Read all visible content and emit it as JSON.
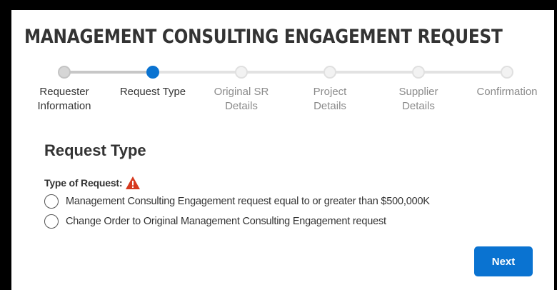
{
  "page": {
    "title": "MANAGEMENT CONSULTING ENGAGEMENT REQUEST"
  },
  "stepper": {
    "current_step": 2,
    "steps": [
      {
        "label": "Requester\nInformation",
        "state": "done"
      },
      {
        "label": "Request Type",
        "state": "active"
      },
      {
        "label": "Original SR\nDetails",
        "state": "pending"
      },
      {
        "label": "Project\nDetails",
        "state": "pending"
      },
      {
        "label": "Supplier\nDetails",
        "state": "pending"
      },
      {
        "label": "Confirmation",
        "state": "pending"
      }
    ]
  },
  "section": {
    "title": "Request Type",
    "field_label": "Type of Request:",
    "field_icon": "warning-icon",
    "options": [
      {
        "label": "Management Consulting Engagement request equal to or greater than $500,000K",
        "selected": false
      },
      {
        "label": "Change Order to Original Management Consulting Engagement request",
        "selected": false
      }
    ]
  },
  "actions": {
    "next_label": "Next"
  },
  "colors": {
    "accent": "#0a73d1",
    "warning": "#d63a1f"
  }
}
